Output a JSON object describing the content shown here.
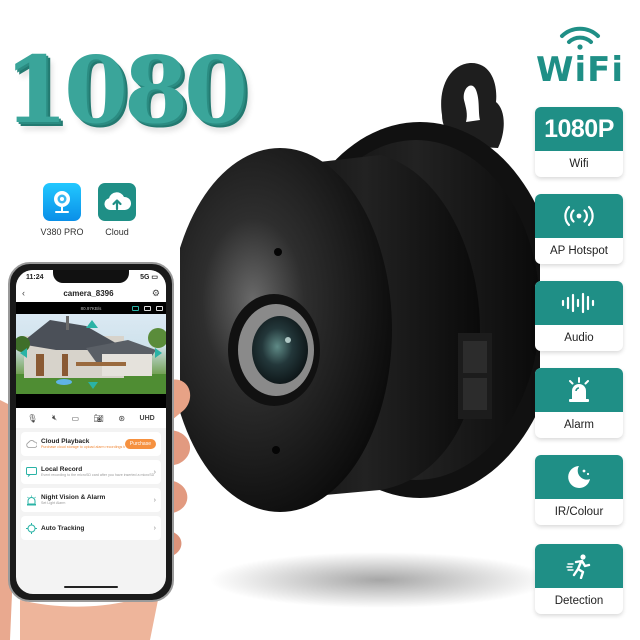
{
  "headline": "1080",
  "apps": [
    {
      "label": "V380 PRO",
      "icon": "camera-app-icon"
    },
    {
      "label": "Cloud",
      "icon": "cloud-upload-icon"
    }
  ],
  "wifi_logo": {
    "text": "WiFi",
    "icon": "wifi-signal-icon"
  },
  "features": [
    {
      "big": "1080P",
      "label": "Wifi",
      "icon": ""
    },
    {
      "big": "",
      "label": "AP Hotspot",
      "icon": "hotspot-icon"
    },
    {
      "big": "",
      "label": "Audio",
      "icon": "audio-wave-icon"
    },
    {
      "big": "",
      "label": "Alarm",
      "icon": "alarm-siren-icon"
    },
    {
      "big": "",
      "label": "IR/Colour",
      "icon": "moon-stars-icon"
    },
    {
      "big": "",
      "label": "Detection",
      "icon": "running-person-icon"
    }
  ],
  "phone": {
    "status": {
      "time": "11:24",
      "network": "5G"
    },
    "nav": {
      "title": "camera_8396"
    },
    "live": {
      "bitrate": "80.97KB/s"
    },
    "controls": {
      "quality": "UHD"
    },
    "menu": [
      {
        "title": "Cloud Playback",
        "subtitle": "Purchase cloud storage to upload alarm recordings to cloud!",
        "action": "Purchase",
        "icon": "cloud-icon"
      },
      {
        "title": "Local Record",
        "subtitle": "Event recording to the microSD card after you have inserted a microSD card",
        "action": "",
        "icon": "local-record-icon"
      },
      {
        "title": "Night Vision & Alarm",
        "subtitle": "Set Light Alarm",
        "action": "",
        "icon": "alarm-light-icon"
      },
      {
        "title": "Auto Tracking",
        "subtitle": "",
        "action": "",
        "icon": "crosshair-icon"
      }
    ]
  },
  "colors": {
    "brand_teal": "#1f8f86",
    "headline_teal": "#3aa59a",
    "purchase_orange": "#f6913f"
  }
}
